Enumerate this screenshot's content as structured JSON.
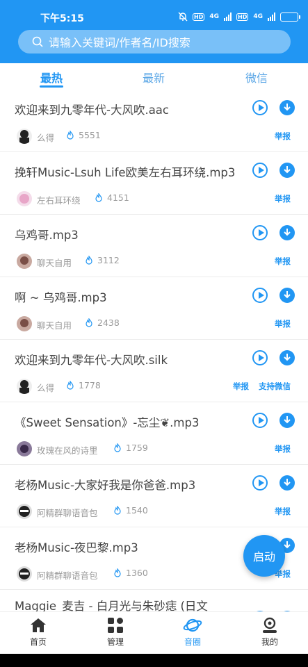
{
  "status": {
    "time": "下午5:15",
    "net1": "4G",
    "net2": "4G",
    "hd": "HD"
  },
  "search": {
    "placeholder": "请输入关键词/作者名/ID搜索"
  },
  "tabs": [
    {
      "label": "最热"
    },
    {
      "label": "最新"
    },
    {
      "label": "微信"
    }
  ],
  "rows": [
    {
      "title": "欢迎来到九零年代-大风吹.aac",
      "author": "么得",
      "likes": "5551",
      "report": "举报",
      "avatar_color": "#222222"
    },
    {
      "title": "挽轩Music-Lsuh Life欧美左右耳环绕.mp3",
      "author": "左右耳环绕",
      "likes": "4151",
      "report": "举报",
      "avatar_color": "#e8a6c8"
    },
    {
      "title": "乌鸡哥.mp3",
      "author": "聊天自用",
      "likes": "3112",
      "report": "举报",
      "avatar_color": "#9a6e66"
    },
    {
      "title": "啊 ~ 乌鸡哥.mp3",
      "author": "聊天自用",
      "likes": "2438",
      "report": "举报",
      "avatar_color": "#9a6e66"
    },
    {
      "title": "欢迎来到九零年代-大风吹.silk",
      "author": "么得",
      "likes": "1778",
      "report": "举报",
      "wechat": "支持微信",
      "avatar_color": "#222222"
    },
    {
      "title": "《Sweet Sensation》-忘尘❦.mp3",
      "author": "玫瑰在风的诗里",
      "likes": "1759",
      "report": "举报",
      "avatar_color": "#5a4a6a"
    },
    {
      "title": "老杨Music-大家好我是你爸爸.mp3",
      "author": "阿精群聊语音包",
      "likes": "1540",
      "report": "举报",
      "avatar_color": "#333333"
    },
    {
      "title": "老杨Music-夜巴黎.mp3",
      "author": "阿精群聊语音包",
      "likes": "1360",
      "report": "举报",
      "avatar_color": "#333333"
    },
    {
      "title": "Maggie_麦吉 - 白月光与朱砂痣 (日文",
      "author": "",
      "likes": "",
      "report": "",
      "avatar_color": "#ffffff"
    }
  ],
  "fab": {
    "label": "启动"
  },
  "nav": [
    {
      "label": "首页"
    },
    {
      "label": "管理"
    },
    {
      "label": "音圈"
    },
    {
      "label": "我的"
    }
  ],
  "colors": {
    "accent": "#2196f3"
  }
}
